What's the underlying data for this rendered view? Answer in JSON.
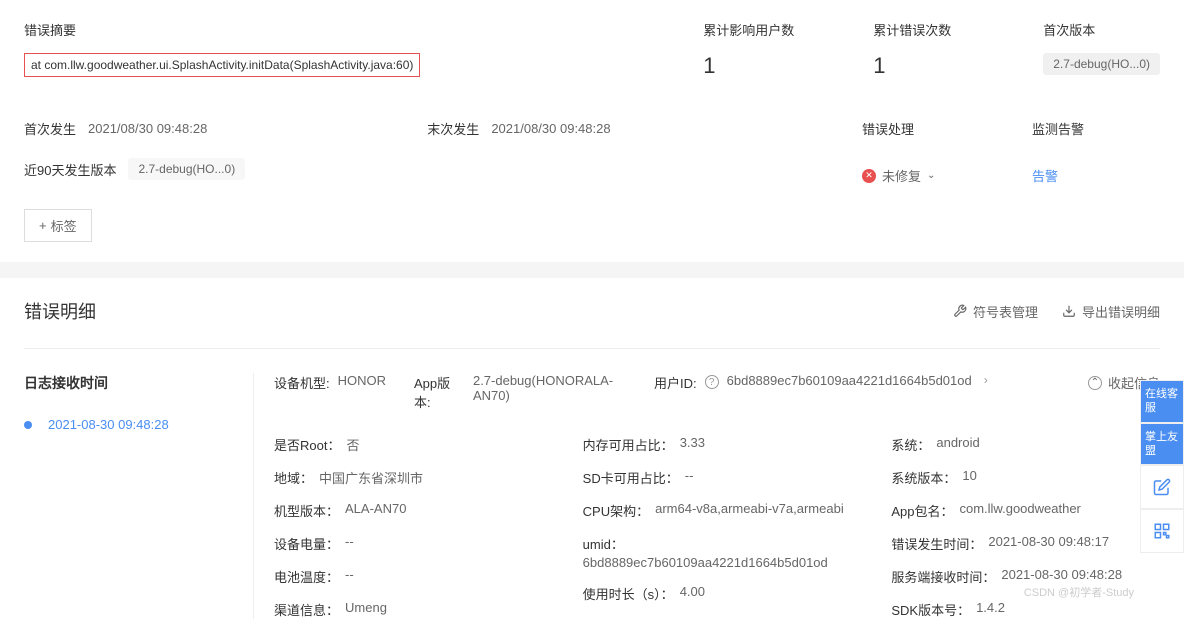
{
  "summary": {
    "title": "错误摘要",
    "stack_trace": "at com.llw.goodweather.ui.SplashActivity.initData(SplashActivity.java:60)",
    "stats": {
      "users_label": "累计影响用户数",
      "users_value": "1",
      "errors_label": "累计错误次数",
      "errors_value": "1",
      "first_version_label": "首次版本",
      "first_version_value": "2.7-debug(HO...0)"
    },
    "first_time_label": "首次发生",
    "first_time_value": "2021/08/30 09:48:28",
    "last_time_label": "末次发生",
    "last_time_value": "2021/08/30 09:48:28",
    "ninety_day_label": "近90天发生版本",
    "ninety_day_value": "2.7-debug(HO...0)",
    "process_label": "错误处理",
    "process_status": "未修复",
    "alert_label": "监测告警",
    "alert_link": "告警",
    "tag_btn": "标签"
  },
  "detail": {
    "title": "错误明细",
    "symbol_mgmt": "符号表管理",
    "export": "导出错误明细",
    "log_title": "日志接收时间",
    "log_time": "2021-08-30 09:48:28",
    "top": {
      "device_label": "设备机型:",
      "device_value": "HONOR",
      "app_label": "App版本:",
      "app_value": "2.7-debug(HONORALA-AN70)",
      "user_label": "用户ID:",
      "user_value": "6bd8889ec7b60109aa4221d1664b5d01od",
      "collapse": "收起信息"
    },
    "left": {
      "root_k": "是否Root：",
      "root_v": "否",
      "region_k": "地域：",
      "region_v": "中国广东省深圳市",
      "model_k": "机型版本：",
      "model_v": "ALA-AN70",
      "battery_k": "设备电量：",
      "battery_v": "--",
      "temp_k": "电池温度：",
      "temp_v": "--",
      "channel_k": "渠道信息：",
      "channel_v": "Umeng"
    },
    "mid": {
      "mem_k": "内存可用占比：",
      "mem_v": "3.33",
      "sd_k": "SD卡可用占比：",
      "sd_v": "--",
      "cpu_k": "CPU架构：",
      "cpu_v": "arm64-v8a,armeabi-v7a,armeabi",
      "umid_k": "umid：",
      "umid_v": "6bd8889ec7b60109aa4221d1664b5d01od",
      "dur_k": "使用时长（s）：",
      "dur_v": "4.00"
    },
    "right": {
      "sys_k": "系统：",
      "sys_v": "android",
      "sysver_k": "系统版本：",
      "sysver_v": "10",
      "pkg_k": "App包名：",
      "pkg_v": "com.llw.goodweather",
      "errtime_k": "错误发生时间：",
      "errtime_v": "2021-08-30 09:48:17",
      "svrtime_k": "服务端接收时间：",
      "svrtime_v": "2021-08-30 09:48:28",
      "sdk_k": "SDK版本号：",
      "sdk_v": "1.4.2"
    }
  },
  "float": {
    "online": "在线客服",
    "palm": "掌上友盟"
  },
  "watermark": "CSDN @初学者-Study"
}
